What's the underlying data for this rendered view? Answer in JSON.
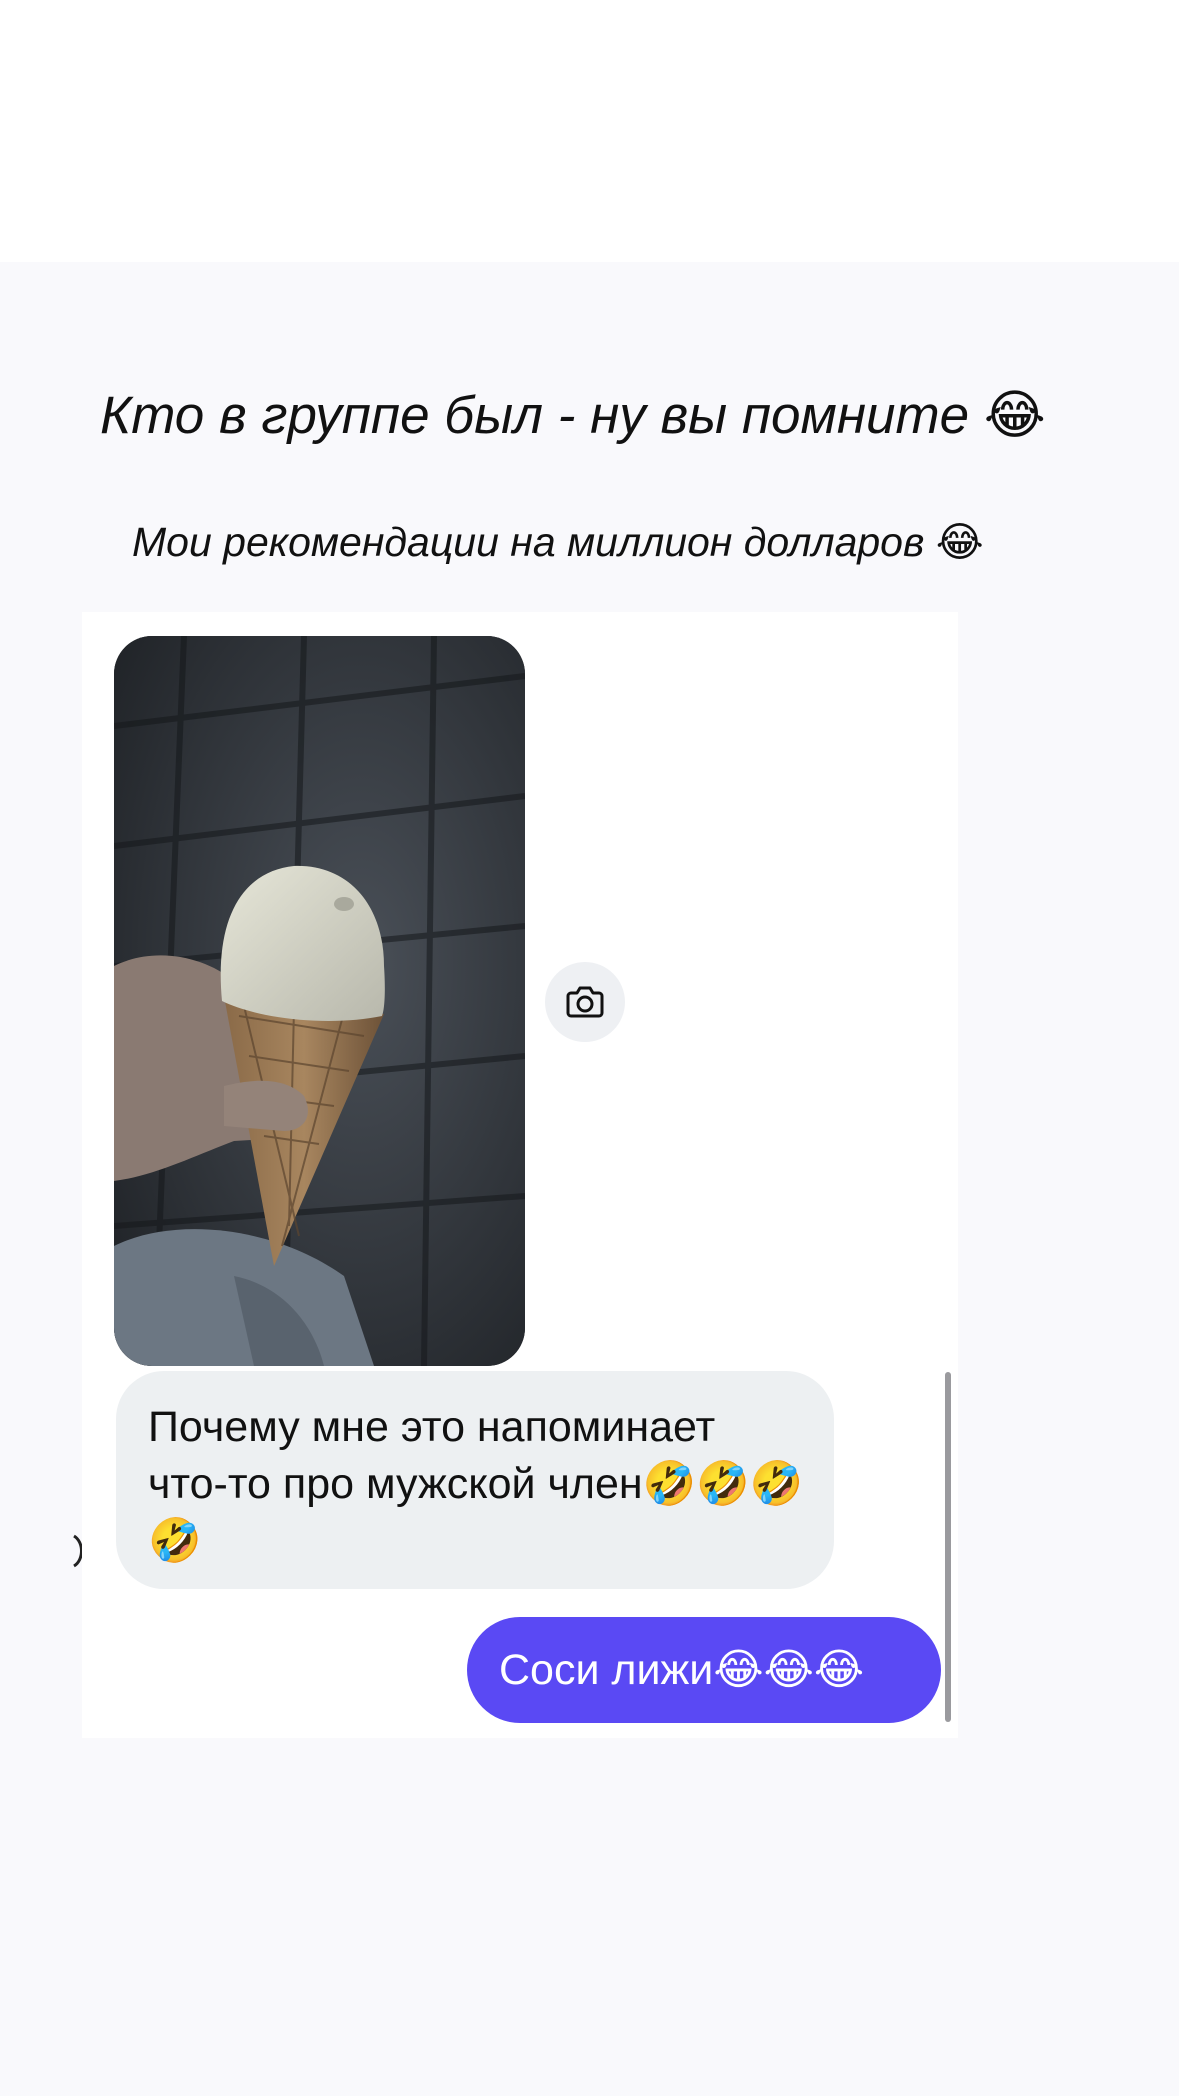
{
  "captions": {
    "line1": "Кто в группе был - ну вы помните 😂",
    "line2": "Мои рекомендации на миллион долларов 😂"
  },
  "chat": {
    "photo": {
      "description_icon": "ice-cream-photo"
    },
    "camera_icon": "camera-icon",
    "incoming_message": "Почему мне это напоминает что-то про мужской член🤣🤣🤣🤣",
    "outgoing_message": "Соси лижи😂😂😂"
  },
  "colors": {
    "outgoing_bubble": "#5a49f4",
    "incoming_bubble": "#edf0f2",
    "page_background": "#f9f9fc"
  }
}
